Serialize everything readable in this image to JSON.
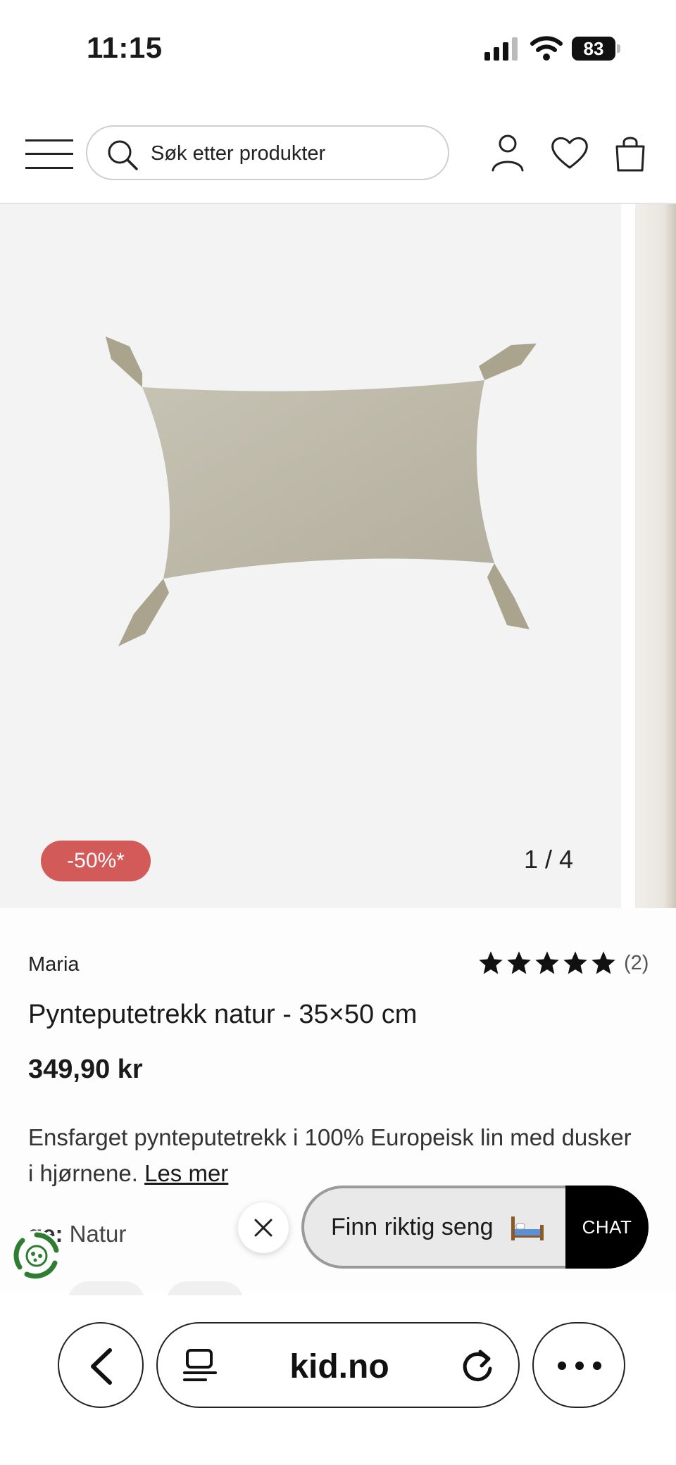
{
  "status_bar": {
    "time": "11:15",
    "battery": "83"
  },
  "header": {
    "search_placeholder": "Søk etter produkter",
    "icons": [
      "menu-icon",
      "search-icon",
      "account-icon",
      "heart-icon",
      "bag-icon"
    ]
  },
  "gallery": {
    "discount_badge": "-50%*",
    "counter": "1 / 4"
  },
  "product": {
    "brand": "Maria",
    "rating_stars": 5,
    "rating_count": "(2)",
    "title": "Pynteputetrekk natur - 35×50 cm",
    "price": "349,90 kr",
    "description": "Ensfarget pynteputetrekk i 100% Europeisk lin med dusker i hjørnene.",
    "read_more": "Les mer",
    "color_label": "ge:",
    "color_value": "Natur"
  },
  "floating": {
    "finn_label": "Finn riktig seng",
    "chat_label": "CHAT"
  },
  "browser": {
    "url": "kid.no"
  },
  "colors": {
    "badge_red": "#d25b59",
    "pillow_linen": "#bcb8a9",
    "chat_black": "#000000",
    "eco_green": "#2e7d32"
  }
}
